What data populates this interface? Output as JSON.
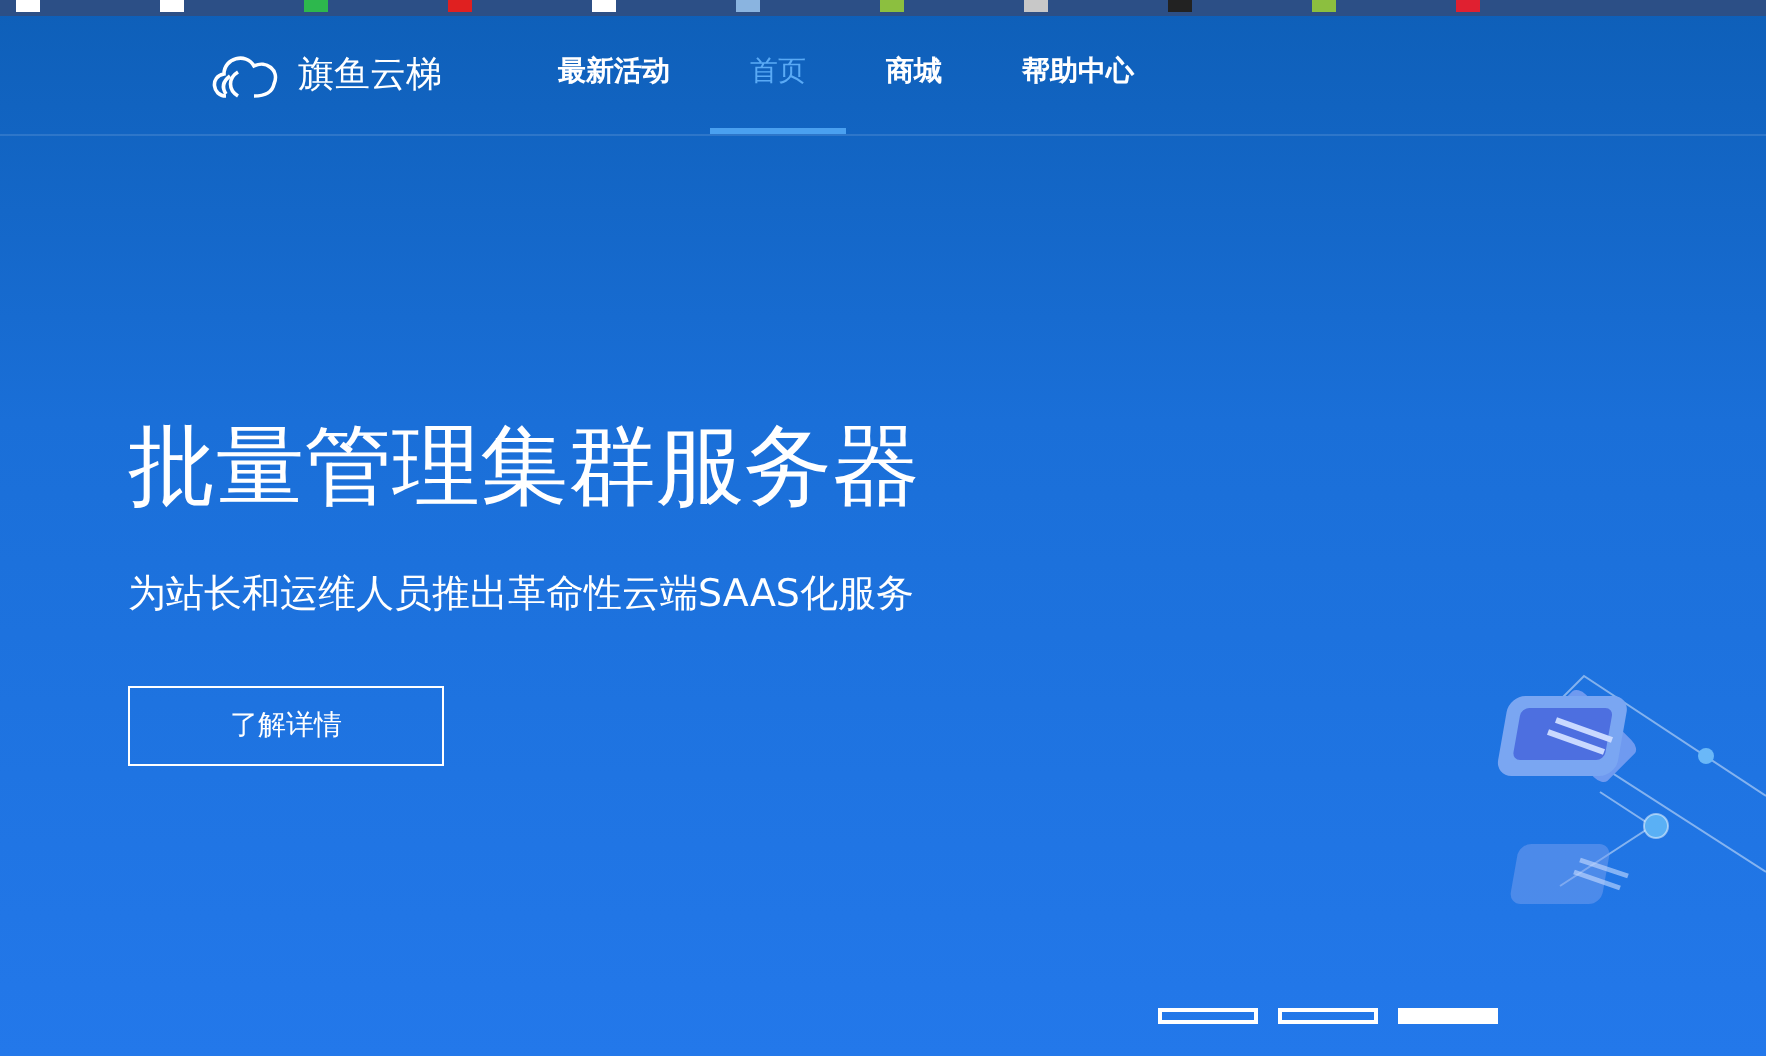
{
  "bookmarks_bar": [
    {
      "color": "#ffffff"
    },
    {
      "color": "#ffffff"
    },
    {
      "color": "#2db84d"
    },
    {
      "color": "#e02020"
    },
    {
      "color": "#ffffff"
    },
    {
      "color": "#8ab4e0"
    },
    {
      "color": "#8cbf3f"
    },
    {
      "color": "#c8c8c8"
    },
    {
      "color": "#222222"
    },
    {
      "color": "#8cbf3f"
    },
    {
      "color": "#e02030"
    }
  ],
  "navbar": {
    "brand": "旗鱼云梯",
    "links": [
      {
        "label": "最新活动",
        "selected": false
      },
      {
        "label": "首页",
        "selected": true
      },
      {
        "label": "商城",
        "selected": false
      },
      {
        "label": "帮助中心",
        "selected": false
      }
    ]
  },
  "hero": {
    "title": "批量管理集群服务器",
    "subtitle": "为站长和运维人员推出革命性云端SAAS化服务",
    "button": "了解详情"
  },
  "carousel_indicators": [
    {
      "selected": false
    },
    {
      "selected": false
    },
    {
      "selected": true
    }
  ]
}
